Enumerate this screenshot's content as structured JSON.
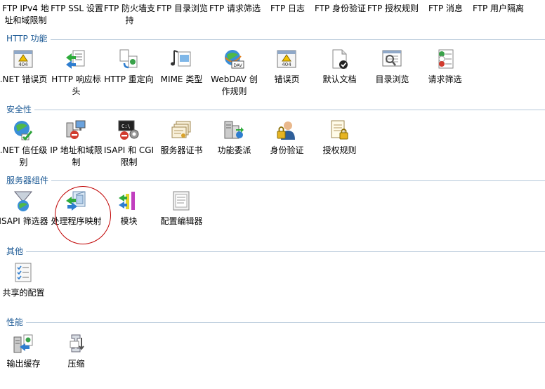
{
  "ftp_row": [
    {
      "label": "FTP IPv4 地址和域限制"
    },
    {
      "label": "FTP SSL 设置"
    },
    {
      "label": "FTP 防火墙支持"
    },
    {
      "label": "FTP 目录浏览"
    },
    {
      "label": "FTP 请求筛选"
    },
    {
      "label": "FTP 日志"
    },
    {
      "label": "FTP 身份验证"
    },
    {
      "label": "FTP 授权规则"
    },
    {
      "label": "FTP 消息"
    },
    {
      "label": "FTP 用户隔离"
    }
  ],
  "sections": {
    "http": {
      "title": "HTTP 功能",
      "items": [
        {
          "label": ".NET 错误页",
          "icon": "error-page-404-icon"
        },
        {
          "label": "HTTP 响应标头",
          "icon": "http-response-headers-icon"
        },
        {
          "label": "HTTP 重定向",
          "icon": "http-redirect-icon"
        },
        {
          "label": "MIME 类型",
          "icon": "mime-types-icon"
        },
        {
          "label": "WebDAV 创作规则",
          "icon": "webdav-icon"
        },
        {
          "label": "错误页",
          "icon": "error-page-404-icon"
        },
        {
          "label": "默认文档",
          "icon": "default-document-icon"
        },
        {
          "label": "目录浏览",
          "icon": "directory-browsing-icon"
        },
        {
          "label": "请求筛选",
          "icon": "request-filtering-icon"
        }
      ]
    },
    "security": {
      "title": "安全性",
      "items": [
        {
          "label": ".NET 信任级别",
          "icon": "trust-levels-icon"
        },
        {
          "label": "IP 地址和域限制",
          "icon": "ip-restrictions-icon"
        },
        {
          "label": "ISAPI 和 CGI 限制",
          "icon": "isapi-cgi-icon"
        },
        {
          "label": "服务器证书",
          "icon": "server-certificates-icon"
        },
        {
          "label": "功能委派",
          "icon": "feature-delegation-icon"
        },
        {
          "label": "身份验证",
          "icon": "authentication-icon"
        },
        {
          "label": "授权规则",
          "icon": "authorization-rules-icon"
        }
      ]
    },
    "server": {
      "title": "服务器组件",
      "items": [
        {
          "label": "ISAPI 筛选器",
          "icon": "isapi-filters-icon"
        },
        {
          "label": "处理程序映射",
          "icon": "handler-mappings-icon"
        },
        {
          "label": "模块",
          "icon": "modules-icon"
        },
        {
          "label": "配置编辑器",
          "icon": "configuration-editor-icon"
        }
      ]
    },
    "other": {
      "title": "其他",
      "items": [
        {
          "label": "共享的配置",
          "icon": "shared-configuration-icon"
        }
      ]
    },
    "perf": {
      "title": "性能",
      "items": [
        {
          "label": "输出缓存",
          "icon": "output-caching-icon"
        },
        {
          "label": "压缩",
          "icon": "compression-icon"
        }
      ]
    }
  }
}
